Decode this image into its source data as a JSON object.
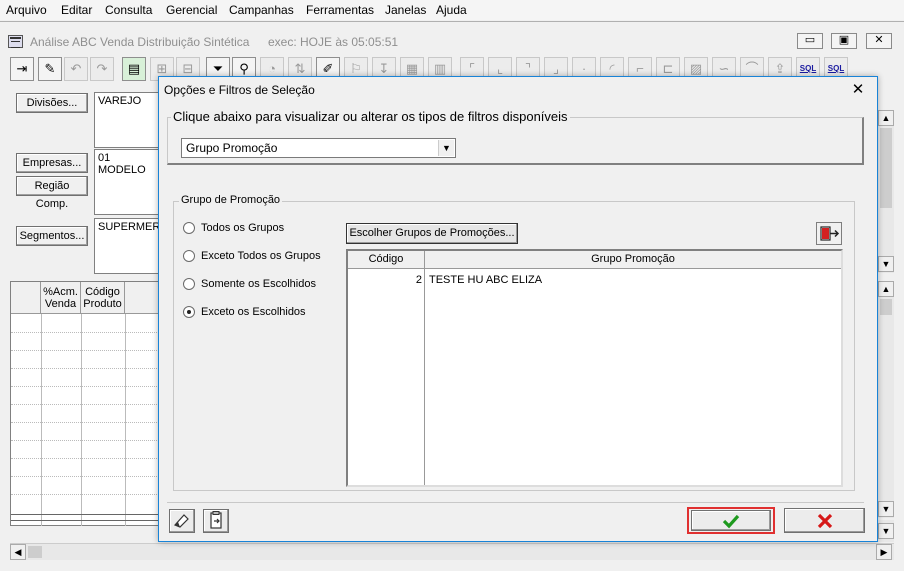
{
  "menu": [
    "Arquivo",
    "Editar",
    "Consulta",
    "Gerencial",
    "Campanhas",
    "Ferramentas",
    "Janelas",
    "Ajuda"
  ],
  "child_window": {
    "title": "Análise ABC Venda Distribuição Sintética",
    "exec": "exec: HOJE às 05:05:51",
    "min": "▭",
    "restore": "▣",
    "close": "✕"
  },
  "toolbar": {
    "sql_label": "SQL"
  },
  "left_panel": {
    "divisoes_label": "Divisões...",
    "divisoes_value": "VAREJO",
    "empresas_label": "Empresas...",
    "empresas_value": "01 MODELO",
    "regiao_label": "Região Comp.",
    "segmentos_label": "Segmentos...",
    "segmentos_value": "SUPERMER"
  },
  "grid": {
    "headers": [
      "%Acm. Venda",
      "Código Produto"
    ]
  },
  "dialog": {
    "title": "Opções e Filtros de Seleção",
    "close": "✕",
    "filter_group_label": "Clique abaixo para visualizar ou alterar os tipos de filtros disponíveis",
    "filter_combo_value": "Grupo Promoção",
    "promo_group_label": "Grupo de Promoção",
    "radios": [
      {
        "label": "Todos os Grupos",
        "checked": false
      },
      {
        "label": "Exceto Todos os Grupos",
        "checked": false
      },
      {
        "label": "Somente os Escolhidos",
        "checked": false
      },
      {
        "label": "Exceto os Escolhidos",
        "checked": true
      }
    ],
    "choose_button": "Escolher Grupos de Promoções...",
    "list": {
      "headers": {
        "codigo": "Código",
        "grupo": "Grupo Promoção"
      },
      "rows": [
        {
          "codigo": "2",
          "grupo": "TESTE HU ABC ELIZA"
        }
      ]
    }
  },
  "colors": {
    "ok": "#1e9a1e",
    "cancel": "#d61818",
    "highlight": "#e03030"
  }
}
